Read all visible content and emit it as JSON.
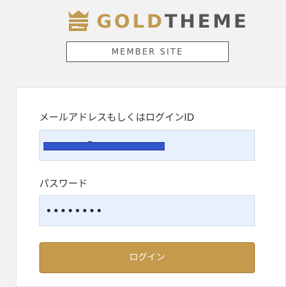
{
  "brand": {
    "logo_icon": "crown-g-icon",
    "name_gold": "GOLD",
    "name_dark": "THEME",
    "subtitle": "MEMBER SITE",
    "gold_color": "#c19a4f",
    "dark_color": "#555555"
  },
  "login_form": {
    "email_label": "メールアドレスもしくはログインID",
    "email_value": "",
    "password_label": "パスワード",
    "password_value": "••••••••",
    "submit_label": "ログイン",
    "button_color": "#c59a4b",
    "field_color": "#e8f0fe"
  }
}
